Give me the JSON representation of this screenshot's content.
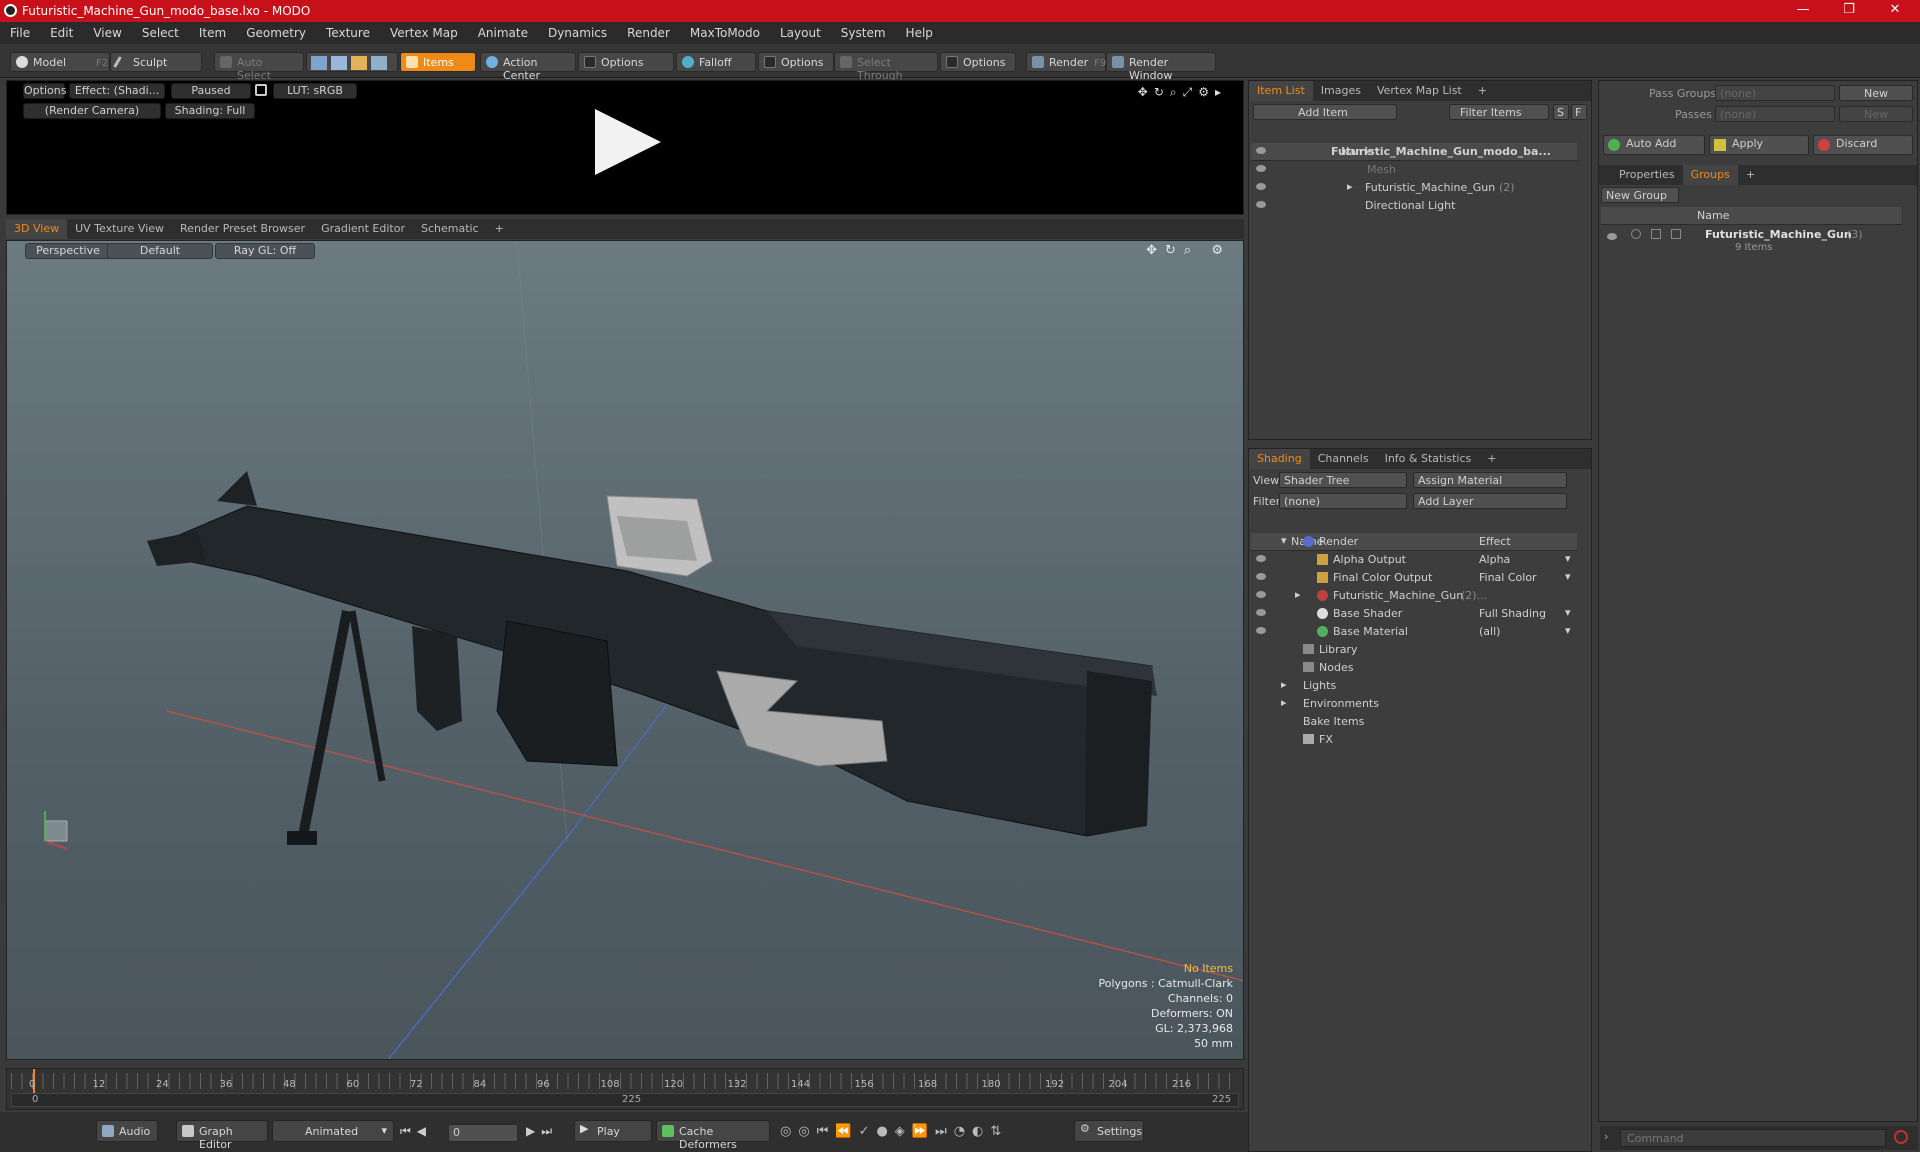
{
  "window": {
    "title": "Futuristic_Machine_Gun_modo_base.lxo - MODO",
    "minimize": "—",
    "maximize": "❐",
    "close": "✕"
  },
  "menu": [
    "File",
    "Edit",
    "View",
    "Select",
    "Item",
    "Geometry",
    "Texture",
    "Vertex Map",
    "Animate",
    "Dynamics",
    "Render",
    "MaxToModo",
    "Layout",
    "System",
    "Help"
  ],
  "toolbar": {
    "model": "Model",
    "model_key": "F2",
    "sculpt": "Sculpt",
    "auto_select": "Auto Select",
    "items": "Items",
    "action_center": "Action Center",
    "options1": "Options",
    "falloff": "Falloff",
    "options2": "Options",
    "select_through": "Select Through",
    "options3": "Options",
    "render": "Render",
    "render_key": "F9",
    "render_window": "Render Window"
  },
  "preview": {
    "options": "Options",
    "effect": "Effect: (Shadi...",
    "paused": "Paused",
    "lut": "LUT: sRGB",
    "camera": "(Render Camera)",
    "shading": "Shading: Full"
  },
  "viewport_tabs": [
    "3D View",
    "UV Texture View",
    "Render Preset Browser",
    "Gradient Editor",
    "Schematic",
    "+"
  ],
  "viewport": {
    "perspective": "Perspective",
    "default": "Default",
    "raygl": "Ray GL: Off",
    "stats": [
      "No Items",
      "Polygons : Catmull-Clark",
      "Channels: 0",
      "Deformers: ON",
      "GL: 2,373,968",
      "50 mm"
    ]
  },
  "timeline": {
    "ticks": [
      "0",
      "12",
      "24",
      "36",
      "48",
      "60",
      "72",
      "84",
      "96",
      "108",
      "120",
      "132",
      "144",
      "156",
      "168",
      "180",
      "192",
      "204",
      "216"
    ],
    "start": "0",
    "mid": "225",
    "end": "225"
  },
  "bottombar": {
    "audio": "Audio",
    "graph_editor": "Graph Editor",
    "animated": "Animated",
    "frame": "0",
    "play": "Play",
    "cache_deformers": "Cache Deformers",
    "settings": "Settings"
  },
  "itemlist": {
    "tabs": [
      "Item List",
      "Images",
      "Vertex Map List",
      "+"
    ],
    "add_item": "Add Item",
    "filter_items": "Filter Items",
    "s": "S",
    "f": "F",
    "col_name": "Name",
    "rows": [
      {
        "label": "Futuristic_Machine_Gun_modo_ba...",
        "count": ""
      },
      {
        "label": "Mesh",
        "count": ""
      },
      {
        "label": "Futuristic_Machine_Gun",
        "count": "(2)"
      },
      {
        "label": "Directional Light",
        "count": ""
      }
    ]
  },
  "shading": {
    "tabs": [
      "Shading",
      "Channels",
      "Info & Statistics",
      "+"
    ],
    "view_label": "View",
    "view_value": "Shader Tree",
    "assign_material": "Assign Material",
    "filter_label": "Filter",
    "filter_value": "(none)",
    "add_layer": "Add Layer",
    "col_name": "Name",
    "col_effect": "Effect",
    "rows": [
      {
        "label": "Render",
        "effect": ""
      },
      {
        "label": "Alpha Output",
        "effect": "Alpha"
      },
      {
        "label": "Final Color Output",
        "effect": "Final Color"
      },
      {
        "label": "Futuristic_Machine_Gun",
        "count": "(2)...",
        "effect": ""
      },
      {
        "label": "Base Shader",
        "effect": "Full Shading"
      },
      {
        "label": "Base Material",
        "effect": "(all)"
      },
      {
        "label": "Library",
        "effect": ""
      },
      {
        "label": "Nodes",
        "effect": ""
      },
      {
        "label": "Lights",
        "effect": ""
      },
      {
        "label": "Environments",
        "effect": ""
      },
      {
        "label": "Bake Items",
        "effect": ""
      },
      {
        "label": "FX",
        "effect": ""
      }
    ]
  },
  "groups": {
    "pass_groups": "Pass Groups",
    "pass_groups_value": "(none)",
    "new1": "New",
    "passes": "Passes",
    "passes_value": "(none)",
    "new2": "New",
    "auto_add": "Auto Add",
    "apply": "Apply",
    "discard": "Discard",
    "tabs": [
      "Properties",
      "Groups",
      "+"
    ],
    "new_group": "New Group",
    "col_name": "Name",
    "group_name": "Futuristic_Machine_Gun",
    "group_count": "(3)",
    "group_items": "9 Items"
  },
  "command": {
    "placeholder": "Command"
  },
  "colors": {
    "accent": "#f08a17",
    "title": "#c8101a"
  }
}
